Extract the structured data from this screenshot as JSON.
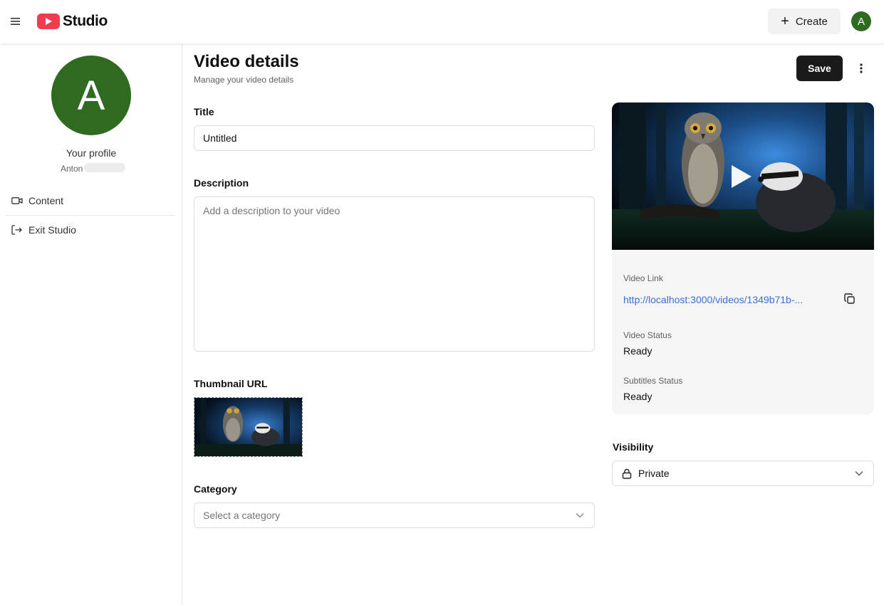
{
  "header": {
    "logo_text": "Studio",
    "create_label": "Create",
    "avatar_letter": "A",
    "menu_icon": "hamburger-menu-icon",
    "brand_color": "#f13a4d",
    "avatar_color": "#2e6b20"
  },
  "sidebar": {
    "avatar_letter": "A",
    "profile_label": "Your profile",
    "profile_name": "Anton",
    "items": [
      {
        "label": "Content",
        "icon": "video-camera-icon"
      },
      {
        "label": "Exit Studio",
        "icon": "exit-icon"
      }
    ]
  },
  "main": {
    "title": "Video details",
    "subtitle": "Manage your video details",
    "save_label": "Save",
    "title_field": {
      "label": "Title",
      "value": "Untitled"
    },
    "description_field": {
      "label": "Description",
      "placeholder": "Add a description to your video",
      "value": ""
    },
    "thumbnail_field": {
      "label": "Thumbnail URL"
    },
    "category_field": {
      "label": "Category",
      "placeholder": "Select a category"
    }
  },
  "card": {
    "video_link_label": "Video Link",
    "video_link": "http://localhost:3000/videos/1349b71b-...",
    "video_status_label": "Video Status",
    "video_status": "Ready",
    "subtitles_status_label": "Subtitles Status",
    "subtitles_status": "Ready",
    "link_color": "#3b6fd8"
  },
  "visibility": {
    "label": "Visibility",
    "selected": "Private",
    "icon": "lock-icon"
  }
}
